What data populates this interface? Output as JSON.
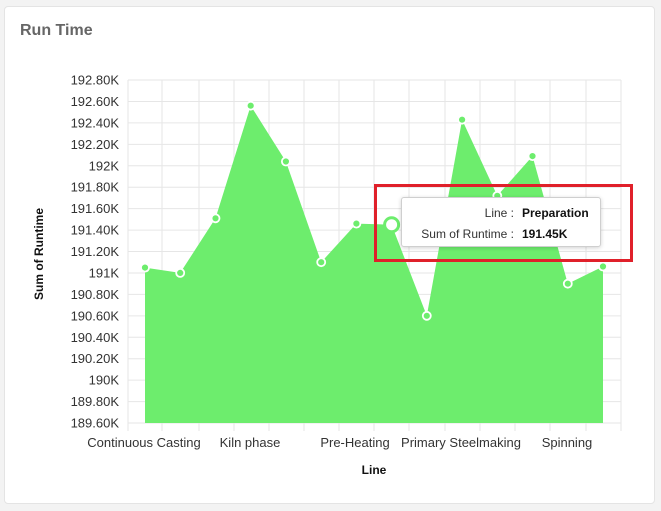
{
  "card": {
    "title": "Run Time"
  },
  "tooltip": {
    "line_key": "Line :",
    "line_value": "Preparation",
    "runtime_key": "Sum of Runtime :",
    "runtime_value": "191.45K"
  },
  "chart_data": {
    "type": "area",
    "xlabel": "Line",
    "ylabel": "Sum of Runtime",
    "ylim": [
      189600,
      192800
    ],
    "ytick_step": 200,
    "yticks": [
      "189.60K",
      "189.80K",
      "190K",
      "190.20K",
      "190.40K",
      "190.60K",
      "190.80K",
      "191K",
      "191.20K",
      "191.40K",
      "191.60K",
      "191.80K",
      "192K",
      "192.20K",
      "192.40K",
      "192.60K",
      "192.80K"
    ],
    "categories": [
      "Continuous Casting",
      "",
      "",
      "Kiln phase",
      "",
      "",
      "Pre-Heating",
      "Preparation",
      "Primary Steelmaking",
      "",
      "",
      "Spinning",
      ""
    ],
    "visible_xticks": [
      "Continuous Casting",
      "Kiln phase",
      "Pre-Heating",
      "Primary Steelmaking",
      "Spinning"
    ],
    "series": [
      {
        "values": [
          191050,
          191000,
          191510,
          192560,
          192040,
          191100,
          191460,
          191450,
          190600,
          192430,
          191720,
          192090,
          190900,
          191060
        ]
      }
    ],
    "hovered_category": "Preparation",
    "hovered_value": 191450,
    "colors": {
      "area": "#6ded6d",
      "marker_fill": "#ffffff",
      "grid": "#e6e6e6"
    },
    "grid": true,
    "legend": "none"
  }
}
